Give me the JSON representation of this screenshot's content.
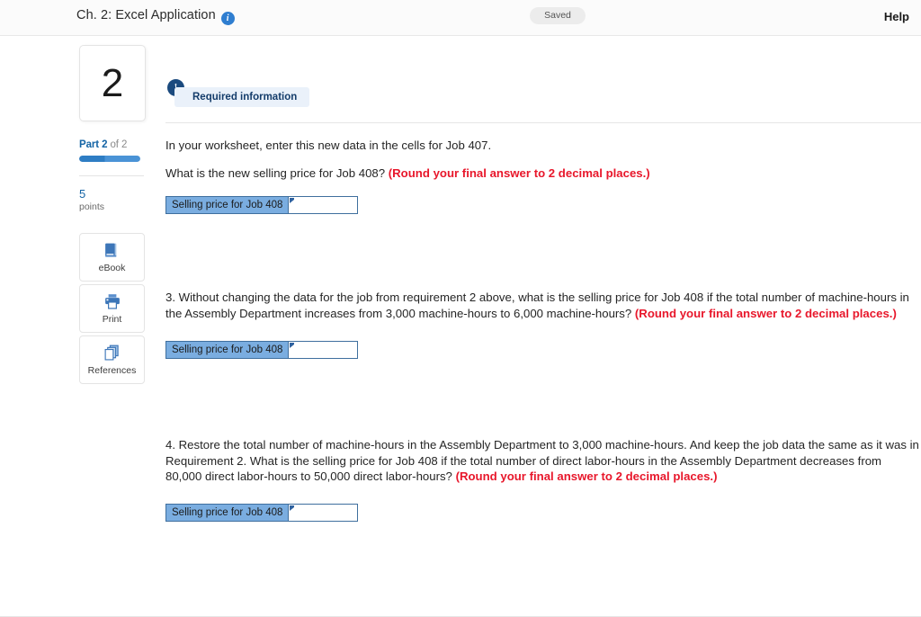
{
  "topbar": {
    "title": "Ch. 2: Excel Application",
    "info_icon": "info-icon",
    "info_glyph": "i",
    "saved_label": "Saved",
    "help_label": "Help"
  },
  "rail": {
    "question_number": "2",
    "part_prefix": "Part",
    "part_current": "2",
    "part_of": "of 2",
    "points_value": "5",
    "points_word": "points",
    "tools": [
      {
        "label": "eBook",
        "icon": "book-icon"
      },
      {
        "label": "Print",
        "icon": "printer-icon"
      },
      {
        "label": "References",
        "icon": "copy-pages-icon"
      }
    ]
  },
  "content": {
    "required_badge_glyph": "!",
    "required_label": "Required information",
    "questions": [
      {
        "paragraphs": [
          {
            "text": "In your worksheet, enter this new data in the cells for Job 407.",
            "red": ""
          },
          {
            "text": "What is the new selling price for Job 408? ",
            "red": "(Round your final answer to 2 decimal places.)"
          }
        ],
        "answer": {
          "label": "Selling price for Job 408",
          "value": "",
          "placeholder": ""
        }
      },
      {
        "paragraphs": [
          {
            "text": "3. Without changing the data for the job from requirement 2 above, what is the selling price for Job 408 if the total number of machine-hours in the Assembly Department increases from 3,000 machine-hours to 6,000 machine-hours? ",
            "red": "(Round your final answer to 2 decimal places.)"
          }
        ],
        "answer": {
          "label": "Selling price for Job 408",
          "value": "",
          "placeholder": ""
        }
      },
      {
        "paragraphs": [
          {
            "text": "4. Restore the total number of machine-hours in the Assembly Department to 3,000 machine-hours. And keep the job data the same as it was in Requirement 2. What is the selling price for Job 408 if the total number of direct labor-hours in the Assembly Department decreases from 80,000 direct labor-hours to 50,000 direct labor-hours? ",
            "red": "(Round your final answer to 2 decimal places.)"
          }
        ],
        "answer": {
          "label": "Selling price for Job 408",
          "value": "",
          "placeholder": ""
        }
      }
    ]
  },
  "colors": {
    "accent_blue": "#1464a5",
    "info_blue": "#2f7ed0",
    "badge_navy": "#1b4a7e",
    "required_pill_bg": "#eaf1fa",
    "red_emphasis": "#e8172b",
    "excel_label_fill": "#7aade0",
    "excel_border": "#3f6f9e"
  }
}
